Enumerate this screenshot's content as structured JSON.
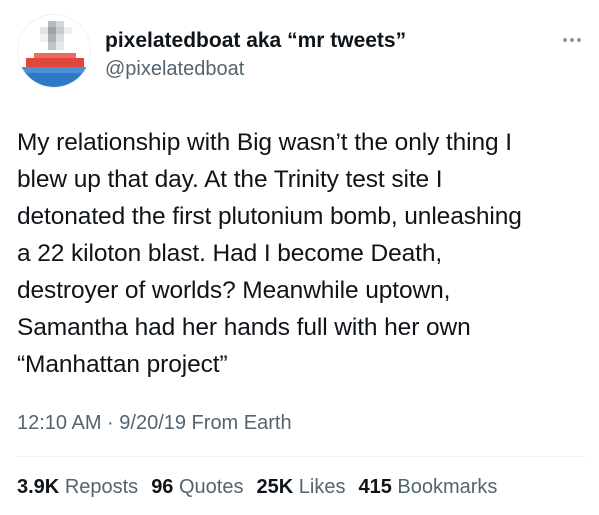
{
  "user": {
    "display_name": "pixelatedboat aka “mr tweets”",
    "handle": "@pixelatedboat",
    "avatar_icon": "pixelated-boat-avatar"
  },
  "more_icon": "more-dots-icon",
  "tweet": {
    "text": "My relationship with Big wasn’t the only thing I\nblew up that day. At the Trinity test site I\ndetonated the first plutonium bomb, unleashing\na 22 kiloton blast. Had I become Death,\ndestroyer of worlds? Meanwhile uptown,\nSamantha had her hands full with her own\n“Manhattan project”",
    "meta": "12:10 AM · 9/20/19 From Earth"
  },
  "stats": [
    {
      "value": "3.9K",
      "label": "Reposts"
    },
    {
      "value": "96",
      "label": "Quotes"
    },
    {
      "value": "25K",
      "label": "Likes"
    },
    {
      "value": "415",
      "label": "Bookmarks"
    }
  ],
  "colors": {
    "text": "#0f1419",
    "secondary": "#536471",
    "divider": "#eff3f4"
  }
}
